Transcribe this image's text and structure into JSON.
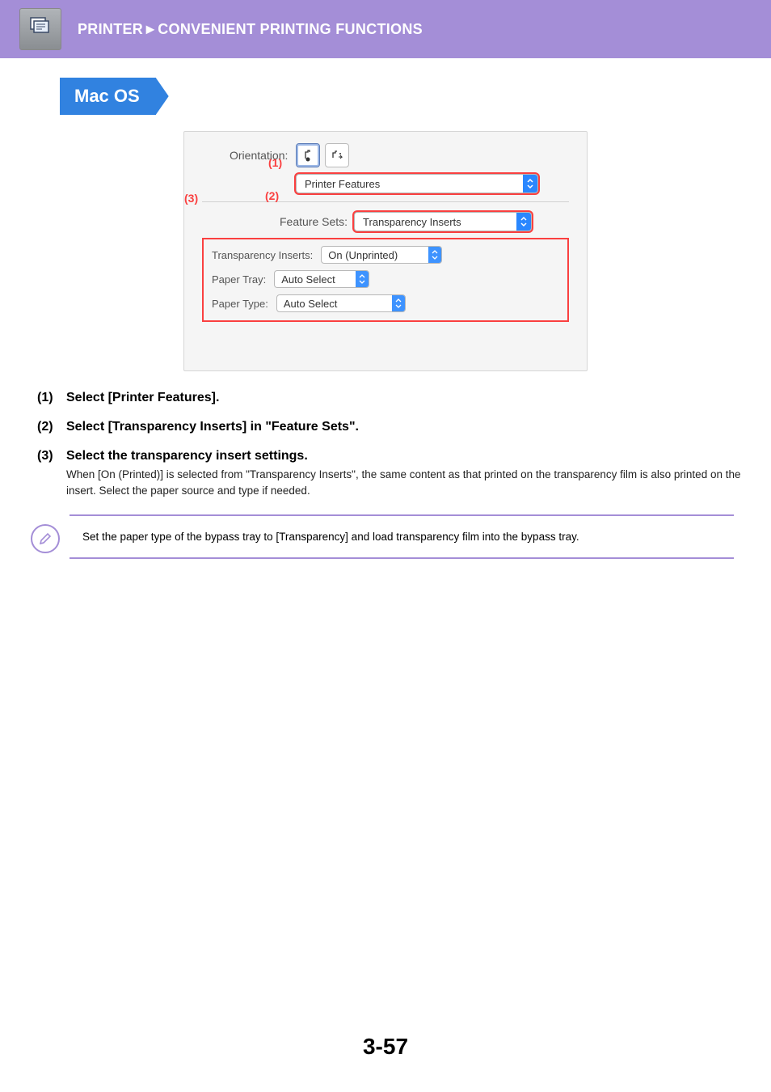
{
  "header": {
    "breadcrumb_section": "PRINTER",
    "breadcrumb_sep": "►",
    "breadcrumb_sub": "CONVENIENT PRINTING FUNCTIONS"
  },
  "os_tab": "Mac OS",
  "dialog": {
    "orientation_label": "Orientation:",
    "callout1": "(1)",
    "callout2": "(2)",
    "callout3": "(3)",
    "main_select": "Printer Features",
    "feature_sets_label": "Feature Sets:",
    "feature_sets_value": "Transparency Inserts",
    "ti_label": "Transparency Inserts:",
    "ti_value": "On (Unprinted)",
    "tray_label": "Paper Tray:",
    "tray_value": "Auto Select",
    "type_label": "Paper Type:",
    "type_value": "Auto Select"
  },
  "steps": [
    {
      "num": "(1)",
      "title": "Select [Printer Features]."
    },
    {
      "num": "(2)",
      "title": "Select [Transparency Inserts] in \"Feature Sets\"."
    },
    {
      "num": "(3)",
      "title": "Select the transparency insert settings.",
      "desc": "When [On (Printed)] is selected from \"Transparency Inserts\", the same content as that printed on the transparency film is also printed on the insert. Select the paper source and type if needed."
    }
  ],
  "note": "Set the paper type of the bypass tray to [Transparency] and load transparency film into the bypass tray.",
  "page_number": "3-57"
}
